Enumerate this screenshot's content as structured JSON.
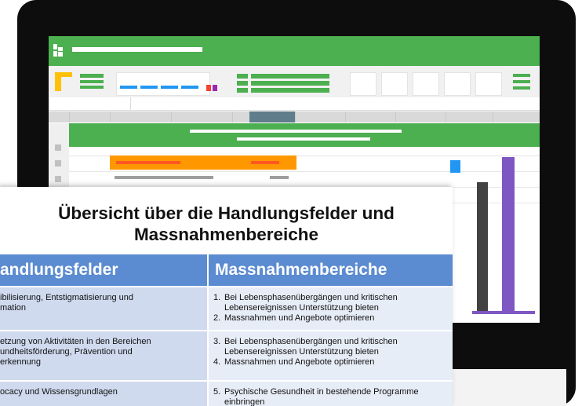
{
  "colors": {
    "appbar": "#4caf50",
    "monitor": "#0d0d0d",
    "orange": "#ff9800",
    "table_header": "#5b8bd0",
    "row_left": "#cfdaef",
    "row_right": "#e7edf7",
    "chart_blue": "#2196f3",
    "chart_dark": "#424242",
    "chart_purple": "#7e57c2"
  },
  "icons": {
    "app_logo": "app-logo-icon",
    "hamburger": "hamburger-menu-icon"
  },
  "slide": {
    "title_line1": "Übersicht über die Handlungsfelder und",
    "title_line2": "Massnahmenbereiche",
    "header_left": "andlungsfelder",
    "header_right": "Massnahmenbereiche",
    "rows": [
      {
        "left": [
          "ibilisierung, Entstigmatisierung und",
          "mation"
        ],
        "right": [
          {
            "num": "1.",
            "text": "Bei Lebensphasenübergängen und kritischen Lebensereignissen Unterstützung bieten"
          },
          {
            "num": "2.",
            "text": "Massnahmen und Angebote optimieren"
          }
        ]
      },
      {
        "left": [
          "etzung von Aktivitäten in den Bereichen",
          "undheitsförderung, Prävention und",
          "erkennung"
        ],
        "right": [
          {
            "num": "3.",
            "text": "Bei Lebensphasenübergängen und kritischen Lebensereignissen Unterstützung bieten"
          },
          {
            "num": "4.",
            "text": "Massnahmen und Angebote optimieren"
          }
        ]
      },
      {
        "left": [
          "ocacy und Wissensgrundlagen"
        ],
        "right": [
          {
            "num": "5.",
            "text": "Psychische Gesundheit in bestehende Programme einbringen"
          }
        ]
      }
    ]
  }
}
